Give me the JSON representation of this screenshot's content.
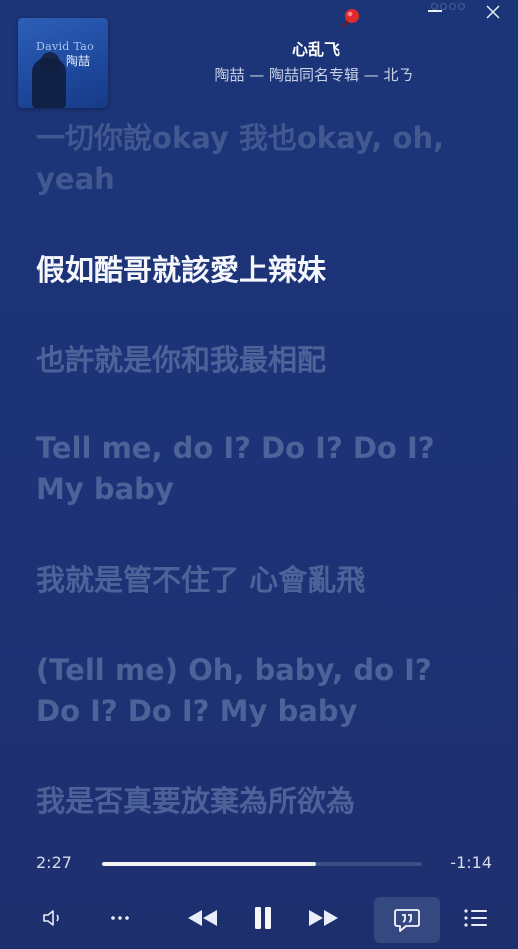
{
  "now_playing": {
    "title": "心乱飞",
    "subtitle": "陶喆 — 陶喆同名专辑 — 北ㄋ",
    "cover_text_line1": "David Tao",
    "cover_text_line2": "陶喆"
  },
  "window": {
    "ghost_text": "ＯＯＯＯ"
  },
  "lyrics": [
    {
      "text": "一切你說okay 我也okay, oh, yeah",
      "state": "past"
    },
    {
      "text": "假如酷哥就該愛上辣妹",
      "state": "active"
    },
    {
      "text": "也許就是你和我最相配",
      "state": "upcoming"
    },
    {
      "text": "Tell me, do I? Do I? Do I?\nMy baby",
      "state": "upcoming"
    },
    {
      "text": "我就是管不住了 心會亂飛",
      "state": "upcoming"
    },
    {
      "text": "(Tell me) Oh, baby, do I?\nDo I? Do I? My baby",
      "state": "upcoming"
    },
    {
      "text": "我是否真要放棄為所欲為",
      "state": "upcoming"
    }
  ],
  "playback": {
    "elapsed": "2:27",
    "remaining": "-1:14",
    "progress": 0.67
  },
  "controls": {
    "volume_icon": "volume-icon",
    "more_icon": "more-icon",
    "previous_icon": "previous-icon",
    "pause_icon": "pause-icon",
    "next_icon": "next-icon",
    "lyrics_icon": "lyrics-quote-icon",
    "queue_icon": "queue-list-icon"
  },
  "colors": {
    "accent_active_lyric": "#f4f6fb",
    "inactive_lyric": "#4c6298",
    "background": "#1c3478"
  }
}
